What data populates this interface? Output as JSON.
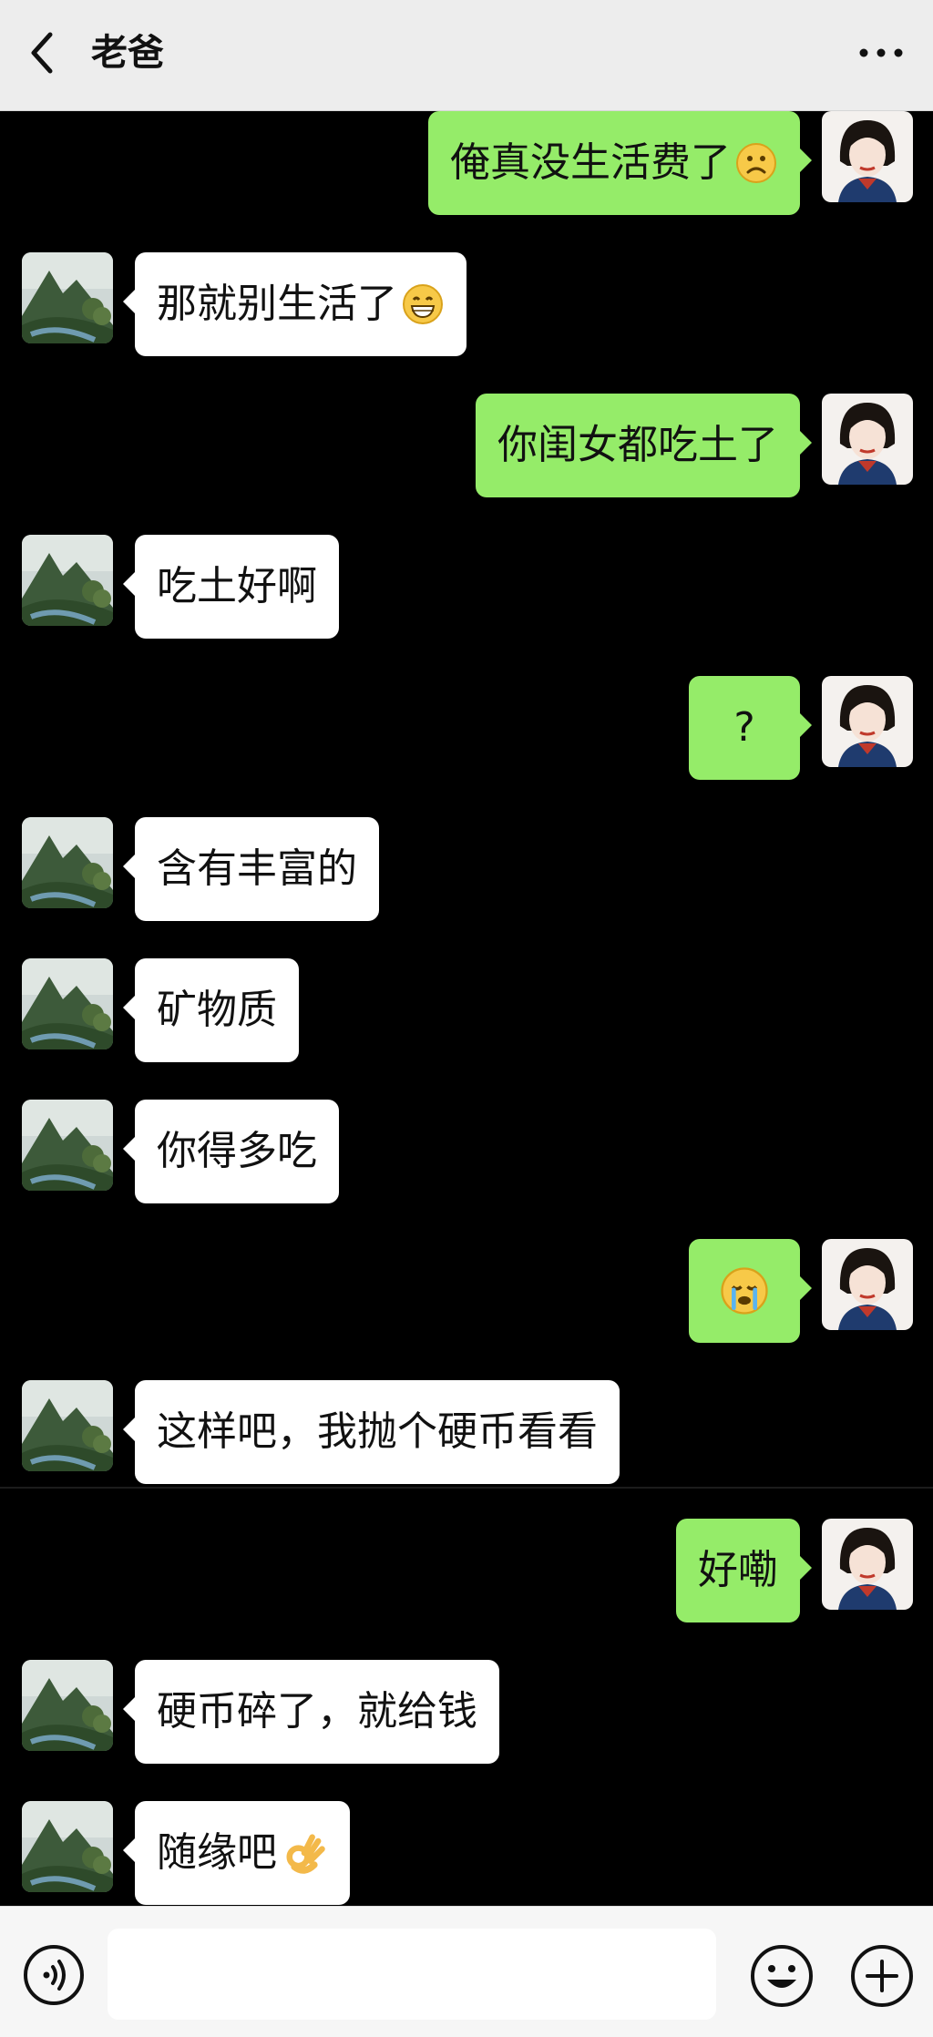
{
  "header": {
    "title": "老爸"
  },
  "icons": {
    "back": "chevron-left-icon",
    "more": "more-dots-icon",
    "voice": "voice-icon",
    "emoji": "emoji-face-icon",
    "plus": "plus-circle-icon"
  },
  "colors": {
    "sent_bubble": "#95ec69",
    "received_bubble": "#ffffff",
    "background": "#000000",
    "header": "#ededed"
  },
  "messages": [
    {
      "side": "right",
      "text": "俺真没生活费了",
      "emoji": "slightly-frowning-face-icon"
    },
    {
      "side": "left",
      "text": "那就别生活了",
      "emoji": "grinning-face-icon"
    },
    {
      "side": "right",
      "text": "你闺女都吃土了"
    },
    {
      "side": "left",
      "text": "吃土好啊"
    },
    {
      "side": "right",
      "text": "?"
    },
    {
      "side": "left",
      "text": "含有丰富的"
    },
    {
      "side": "left",
      "text": "矿物质"
    },
    {
      "side": "left",
      "text": "你得多吃"
    },
    {
      "side": "right",
      "text": "",
      "emoji": "crying-face-icon"
    },
    {
      "side": "left",
      "text": "这样吧，我抛个硬币看看"
    },
    {
      "side": "right",
      "text": "好嘞"
    },
    {
      "side": "left",
      "text": "硬币碎了，就给钱"
    },
    {
      "side": "left",
      "text": "随缘吧",
      "emoji": "ok-hand-icon"
    }
  ],
  "input": {
    "value": "",
    "placeholder": ""
  }
}
